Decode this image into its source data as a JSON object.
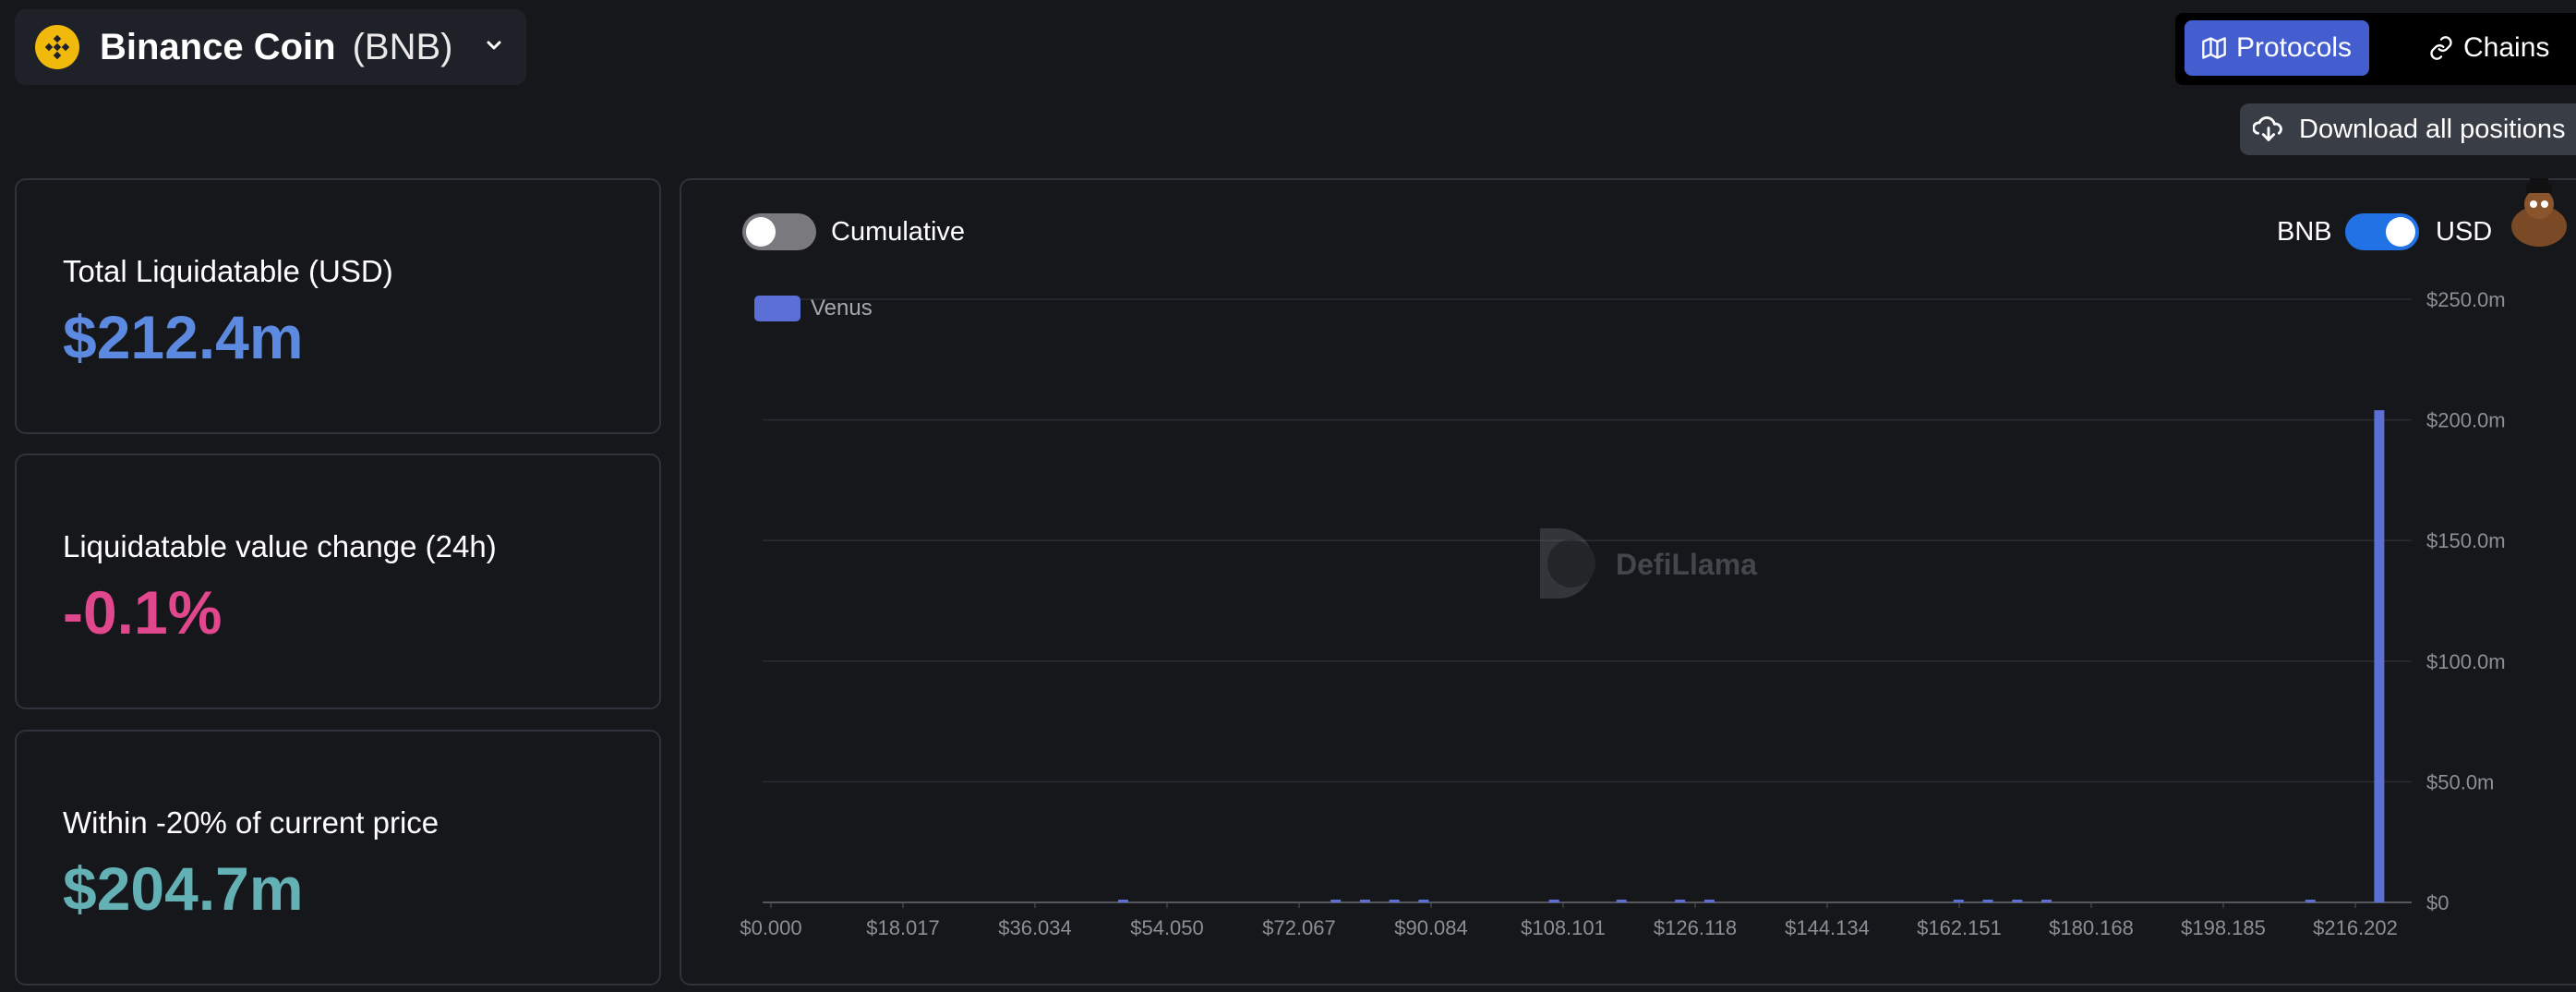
{
  "coin": {
    "name": "Binance Coin",
    "symbol": "(BNB)",
    "logo_color": "#f0b90b"
  },
  "view_switch": {
    "protocols_label": "Protocols",
    "chains_label": "Chains",
    "selected": "Protocols"
  },
  "download_label": "Download all positions",
  "stats": {
    "total_label": "Total Liquidatable (USD)",
    "total_value": "$212.4m",
    "change_label": "Liquidatable value change (24h)",
    "change_value": "-0.1%",
    "within_label": "Within -20% of current price",
    "within_value": "$204.7m"
  },
  "colors": {
    "total": "#5c8ae0",
    "change": "#e0478d",
    "within": "#63b0b5",
    "accent": "#445ed0",
    "bar": "#5c6fd6"
  },
  "chart_controls": {
    "cumulative_label": "Cumulative",
    "cumulative_on": false,
    "bnb_label": "BNB",
    "usd_label": "USD",
    "usd_selected": true
  },
  "watermark": "DefiLlama",
  "chart_data": {
    "type": "bar",
    "series": [
      {
        "name": "Venus",
        "points": [
          {
            "x": 48.0,
            "y": 0.4
          },
          {
            "x": 77.0,
            "y": 0.3
          },
          {
            "x": 81.0,
            "y": 0.5
          },
          {
            "x": 85.0,
            "y": 0.3
          },
          {
            "x": 89.0,
            "y": 0.3
          },
          {
            "x": 106.8,
            "y": 0.9
          },
          {
            "x": 116.0,
            "y": 0.4
          },
          {
            "x": 124.0,
            "y": 0.3
          },
          {
            "x": 128.0,
            "y": 0.6
          },
          {
            "x": 162.0,
            "y": 1.1
          },
          {
            "x": 166.0,
            "y": 1.0
          },
          {
            "x": 170.0,
            "y": 0.5
          },
          {
            "x": 174.0,
            "y": 0.3
          },
          {
            "x": 210.0,
            "y": 0.3
          },
          {
            "x": 219.4,
            "y": 204.0
          }
        ]
      }
    ],
    "x_ticks": [
      "$0.000",
      "$18.017",
      "$36.034",
      "$54.050",
      "$72.067",
      "$90.084",
      "$108.101",
      "$126.118",
      "$144.134",
      "$162.151",
      "$180.168",
      "$198.185",
      "$216.202"
    ],
    "y_ticks": [
      "$0",
      "$50.0m",
      "$100.0m",
      "$150.0m",
      "$200.0m",
      "$250.0m"
    ],
    "xlim": [
      0,
      224.65
    ],
    "ylim": [
      0,
      250
    ],
    "legend_position": "top-left",
    "grid": true
  }
}
